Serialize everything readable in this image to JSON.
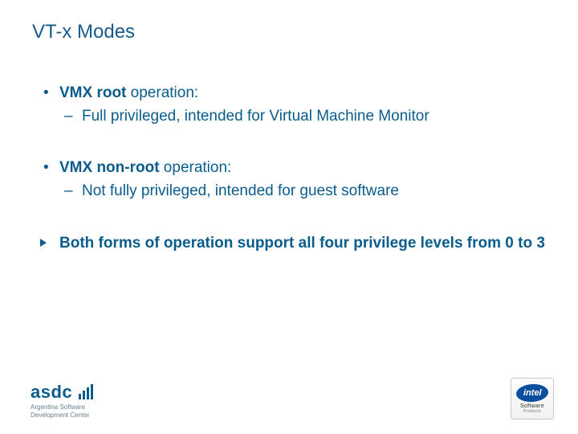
{
  "title": "VT-x Modes",
  "bullet1": {
    "bold": "VMX root",
    "rest": " operation:",
    "sub": "Full privileged, intended for Virtual Machine Monitor"
  },
  "bullet2": {
    "bold": "VMX non-root",
    "rest": " operation:",
    "sub": "Not fully privileged, intended for guest software"
  },
  "arrow_line": "Both forms of operation support all four privilege levels from 0 to 3",
  "footer": {
    "asdc": "asdc",
    "asdc_sub1": "Argentina Software",
    "asdc_sub2": "Development Center",
    "intel": "intel",
    "intel_sub1": "Software",
    "intel_sub2": "Products"
  }
}
